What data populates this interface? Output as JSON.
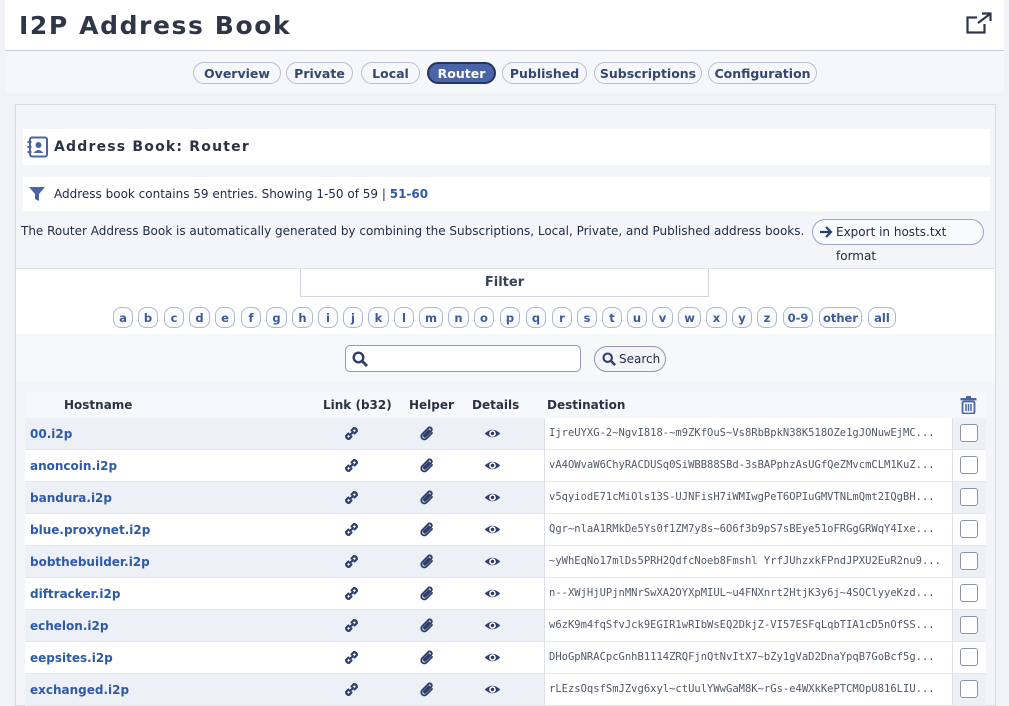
{
  "app": {
    "title": "I2P Address Book"
  },
  "tabs": [
    {
      "label": "Overview"
    },
    {
      "label": "Private"
    },
    {
      "label": "Local"
    },
    {
      "label": "Router",
      "active": true
    },
    {
      "label": "Published"
    },
    {
      "label": "Subscriptions"
    },
    {
      "label": "Configuration"
    }
  ],
  "section": {
    "title": "Address Book: Router"
  },
  "summary": {
    "text": "Address book contains 59 entries. Showing 1-50 of 59 | ",
    "next_page": "51-60"
  },
  "description": "The Router Address Book is automatically generated by combining the Subscriptions, Local, Private, and Published address books.",
  "export": {
    "label": "Export in hosts.txt format"
  },
  "filter": {
    "title": "Filter",
    "letters": [
      "a",
      "b",
      "c",
      "d",
      "e",
      "f",
      "g",
      "h",
      "i",
      "j",
      "k",
      "l",
      "m",
      "n",
      "o",
      "p",
      "q",
      "r",
      "s",
      "t",
      "u",
      "v",
      "w",
      "x",
      "y",
      "z",
      "0-9",
      "other",
      "all"
    ]
  },
  "search": {
    "value": "",
    "button_label": "Search"
  },
  "table": {
    "headers": {
      "hostname": "Hostname",
      "link": "Link (b32)",
      "helper": "Helper",
      "details": "Details",
      "destination": "Destination"
    },
    "rows": [
      {
        "host": "00.i2p",
        "dest": "IjreUYXG-2~NgvI818-~m9ZKfOuS~Vs8RbBpkN38K518OZe1gJONuwEjMC..."
      },
      {
        "host": "anoncoin.i2p",
        "dest": "vA4OWvaW6ChyRACDUSq0SiWBB88SBd-3sBAPphzAsUGfQeZMvcmCLM1KuZ..."
      },
      {
        "host": "bandura.i2p",
        "dest": "v5qyiodE71cMiOls13S-UJNFisH7iWMIwgPeT6OPIuGMVTNLmQmt2IQgBH..."
      },
      {
        "host": "blue.proxynet.i2p",
        "dest": "Qgr~nlaA1RMkDe5Ys0f1ZM7y8s~6O6f3b9pS7sBEye51oFRGgGRWqY4Ixe..."
      },
      {
        "host": "bobthebuilder.i2p",
        "dest": "~yWhEqNo17mlDs5PRH2QdfcNoeb8Fmshl YrfJUhzxkFPndJPXU2EuR2nu9..."
      },
      {
        "host": "diftracker.i2p",
        "dest": "n--XWjHjUPjnMNrSwXA2OYXpMIUL~u4FNXnrt2HtjK3y6j~4SOClyyeKzd..."
      },
      {
        "host": "echelon.i2p",
        "dest": "w6zK9m4fqSfvJck9EGIR1wRIbWsEQ2DkjZ-VI57ESFqLqbTIA1cD5nOfSS..."
      },
      {
        "host": "eepsites.i2p",
        "dest": "DHoGpNRACpcGnhB1114ZRQFjnQtNvItX7~bZy1gVaD2DnaYpqB7GoBcf5g..."
      },
      {
        "host": "exchanged.i2p",
        "dest": "rLEzsOqsfSmJZvg6xyl~ctUulYWwGaM8K~rGs-e4WXkKePTCMOpU816LIU..."
      }
    ]
  }
}
